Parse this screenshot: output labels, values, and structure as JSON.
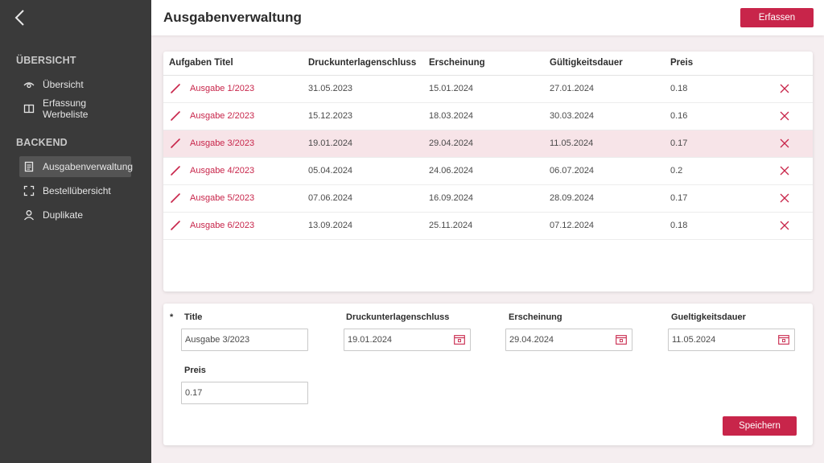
{
  "sidebar": {
    "section_overview": "ÜBERSICHT",
    "section_backend": "BACKEND",
    "items": [
      {
        "label": "Übersicht",
        "icon": "eye-icon"
      },
      {
        "label": "Erfassung Werbeliste",
        "icon": "book-icon"
      },
      {
        "label": "Ausgabenverwaltung",
        "icon": "document-icon",
        "active": true
      },
      {
        "label": "Bestellübersicht",
        "icon": "expand-icon"
      },
      {
        "label": "Duplikate",
        "icon": "user-icon"
      }
    ]
  },
  "header": {
    "title": "Ausgabenverwaltung",
    "add_button": "Erfassen"
  },
  "table": {
    "columns": [
      "Aufgaben Titel",
      "Druckunterlagenschluss",
      "Erscheinung",
      "Gültigkeitsdauer",
      "Preis"
    ],
    "rows": [
      {
        "title": "Ausgabe 1/2023",
        "druck": "31.05.2023",
        "erscheinung": "15.01.2024",
        "gueltig": "27.01.2024",
        "preis": "0.18"
      },
      {
        "title": "Ausgabe 2/2023",
        "druck": "15.12.2023",
        "erscheinung": "18.03.2024",
        "gueltig": "30.03.2024",
        "preis": "0.16"
      },
      {
        "title": "Ausgabe 3/2023",
        "druck": "19.01.2024",
        "erscheinung": "29.04.2024",
        "gueltig": "11.05.2024",
        "preis": "0.17",
        "selected": true
      },
      {
        "title": "Ausgabe 4/2023",
        "druck": "05.04.2024",
        "erscheinung": "24.06.2024",
        "gueltig": "06.07.2024",
        "preis": "0.2"
      },
      {
        "title": "Ausgabe 5/2023",
        "druck": "07.06.2024",
        "erscheinung": "16.09.2024",
        "gueltig": "28.09.2024",
        "preis": "0.17"
      },
      {
        "title": "Ausgabe 6/2023",
        "druck": "13.09.2024",
        "erscheinung": "25.11.2024",
        "gueltig": "07.12.2024",
        "preis": "0.18"
      }
    ]
  },
  "form": {
    "required_marker": "*",
    "title_label": "Title",
    "title_value": "Ausgabe 3/2023",
    "druck_label": "Druckunterlagenschluss",
    "druck_value": "19.01.2024",
    "erscheinung_label": "Erscheinung",
    "erscheinung_value": "29.04.2024",
    "gueltig_label": "Gueltigkeitsdauer",
    "gueltig_value": "11.05.2024",
    "preis_label": "Preis",
    "preis_value": "0.17",
    "save_button": "Speichern"
  },
  "colors": {
    "accent": "#c8254a",
    "sidebar_bg": "#3a3a3a",
    "selected_row": "#f7e4e8",
    "page_bg": "#f5eef0"
  }
}
